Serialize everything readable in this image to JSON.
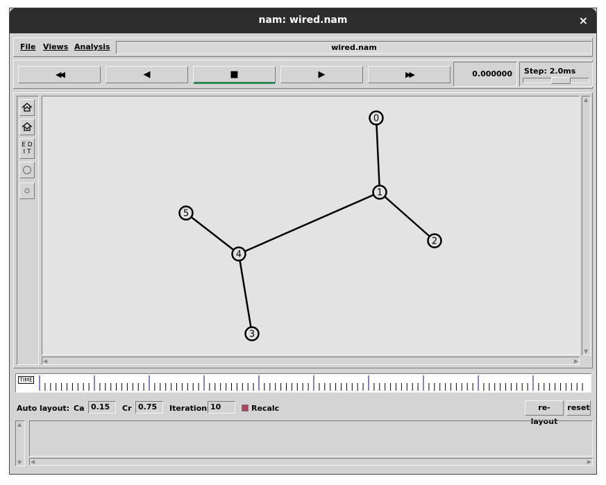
{
  "window": {
    "title": "nam: wired.nam",
    "close_glyph": "×"
  },
  "menus": [
    {
      "label": "File"
    },
    {
      "label": "Views"
    },
    {
      "label": "Analysis"
    }
  ],
  "filename": "wired.nam",
  "playback": {
    "buttons": [
      {
        "name": "rewind-button",
        "icon": "fast-rewind-icon",
        "glyph": "◀◀"
      },
      {
        "name": "back-button",
        "icon": "play-backward-icon",
        "glyph": "◀"
      },
      {
        "name": "stop-button",
        "icon": "stop-icon",
        "glyph": "■"
      },
      {
        "name": "play-button",
        "icon": "play-icon",
        "glyph": "▶"
      },
      {
        "name": "fast-forward-button",
        "icon": "fast-forward-icon",
        "glyph": "▶▶"
      }
    ],
    "time": "0.000000",
    "step_label": "Step: 2.0ms",
    "active_color": "#2e8b57"
  },
  "tools": [
    {
      "name": "zoom-in-icon"
    },
    {
      "name": "zoom-out-icon"
    },
    {
      "name": "edit-button",
      "label": "E D\nI T"
    },
    {
      "name": "large-node-icon"
    },
    {
      "name": "small-node-icon"
    }
  ],
  "network": {
    "nodes": [
      {
        "id": "0",
        "label": "0"
      },
      {
        "id": "1",
        "label": "1"
      },
      {
        "id": "2",
        "label": "2"
      },
      {
        "id": "3",
        "label": "3"
      },
      {
        "id": "4",
        "label": "4"
      },
      {
        "id": "5",
        "label": "5"
      }
    ],
    "links": [
      [
        "0",
        "1"
      ],
      [
        "1",
        "2"
      ],
      [
        "1",
        "4"
      ],
      [
        "4",
        "5"
      ],
      [
        "4",
        "3"
      ]
    ]
  },
  "timeline_label": "TIME",
  "autolayout": {
    "label": "Auto layout:",
    "ca_label": "Ca",
    "ca_value": "0.15",
    "cr_label": "Cr",
    "cr_value": "0.75",
    "iter_label": "Iterations",
    "iter_value": "10",
    "recalc_label": "Recalc",
    "relayout_label": "re-layout",
    "reset_label": "reset"
  }
}
